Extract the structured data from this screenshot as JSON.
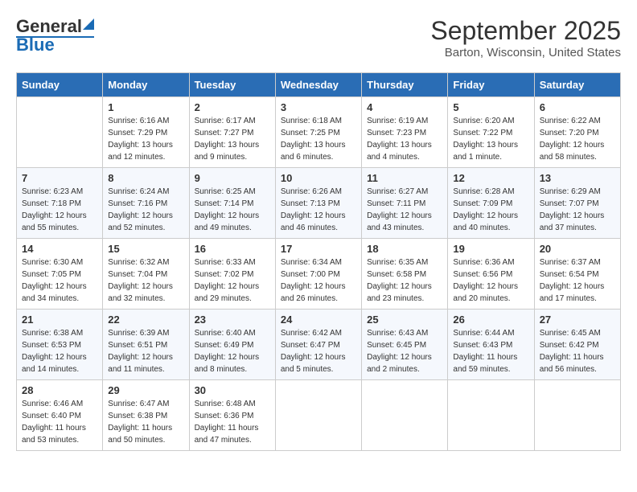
{
  "header": {
    "logo_line1": "General",
    "logo_line2": "Blue",
    "title": "September 2025",
    "subtitle": "Barton, Wisconsin, United States"
  },
  "calendar": {
    "days": [
      "Sunday",
      "Monday",
      "Tuesday",
      "Wednesday",
      "Thursday",
      "Friday",
      "Saturday"
    ],
    "weeks": [
      [
        {
          "date": "",
          "info": ""
        },
        {
          "date": "1",
          "info": "Sunrise: 6:16 AM\nSunset: 7:29 PM\nDaylight: 13 hours\nand 12 minutes."
        },
        {
          "date": "2",
          "info": "Sunrise: 6:17 AM\nSunset: 7:27 PM\nDaylight: 13 hours\nand 9 minutes."
        },
        {
          "date": "3",
          "info": "Sunrise: 6:18 AM\nSunset: 7:25 PM\nDaylight: 13 hours\nand 6 minutes."
        },
        {
          "date": "4",
          "info": "Sunrise: 6:19 AM\nSunset: 7:23 PM\nDaylight: 13 hours\nand 4 minutes."
        },
        {
          "date": "5",
          "info": "Sunrise: 6:20 AM\nSunset: 7:22 PM\nDaylight: 13 hours\nand 1 minute."
        },
        {
          "date": "6",
          "info": "Sunrise: 6:22 AM\nSunset: 7:20 PM\nDaylight: 12 hours\nand 58 minutes."
        }
      ],
      [
        {
          "date": "7",
          "info": "Sunrise: 6:23 AM\nSunset: 7:18 PM\nDaylight: 12 hours\nand 55 minutes."
        },
        {
          "date": "8",
          "info": "Sunrise: 6:24 AM\nSunset: 7:16 PM\nDaylight: 12 hours\nand 52 minutes."
        },
        {
          "date": "9",
          "info": "Sunrise: 6:25 AM\nSunset: 7:14 PM\nDaylight: 12 hours\nand 49 minutes."
        },
        {
          "date": "10",
          "info": "Sunrise: 6:26 AM\nSunset: 7:13 PM\nDaylight: 12 hours\nand 46 minutes."
        },
        {
          "date": "11",
          "info": "Sunrise: 6:27 AM\nSunset: 7:11 PM\nDaylight: 12 hours\nand 43 minutes."
        },
        {
          "date": "12",
          "info": "Sunrise: 6:28 AM\nSunset: 7:09 PM\nDaylight: 12 hours\nand 40 minutes."
        },
        {
          "date": "13",
          "info": "Sunrise: 6:29 AM\nSunset: 7:07 PM\nDaylight: 12 hours\nand 37 minutes."
        }
      ],
      [
        {
          "date": "14",
          "info": "Sunrise: 6:30 AM\nSunset: 7:05 PM\nDaylight: 12 hours\nand 34 minutes."
        },
        {
          "date": "15",
          "info": "Sunrise: 6:32 AM\nSunset: 7:04 PM\nDaylight: 12 hours\nand 32 minutes."
        },
        {
          "date": "16",
          "info": "Sunrise: 6:33 AM\nSunset: 7:02 PM\nDaylight: 12 hours\nand 29 minutes."
        },
        {
          "date": "17",
          "info": "Sunrise: 6:34 AM\nSunset: 7:00 PM\nDaylight: 12 hours\nand 26 minutes."
        },
        {
          "date": "18",
          "info": "Sunrise: 6:35 AM\nSunset: 6:58 PM\nDaylight: 12 hours\nand 23 minutes."
        },
        {
          "date": "19",
          "info": "Sunrise: 6:36 AM\nSunset: 6:56 PM\nDaylight: 12 hours\nand 20 minutes."
        },
        {
          "date": "20",
          "info": "Sunrise: 6:37 AM\nSunset: 6:54 PM\nDaylight: 12 hours\nand 17 minutes."
        }
      ],
      [
        {
          "date": "21",
          "info": "Sunrise: 6:38 AM\nSunset: 6:53 PM\nDaylight: 12 hours\nand 14 minutes."
        },
        {
          "date": "22",
          "info": "Sunrise: 6:39 AM\nSunset: 6:51 PM\nDaylight: 12 hours\nand 11 minutes."
        },
        {
          "date": "23",
          "info": "Sunrise: 6:40 AM\nSunset: 6:49 PM\nDaylight: 12 hours\nand 8 minutes."
        },
        {
          "date": "24",
          "info": "Sunrise: 6:42 AM\nSunset: 6:47 PM\nDaylight: 12 hours\nand 5 minutes."
        },
        {
          "date": "25",
          "info": "Sunrise: 6:43 AM\nSunset: 6:45 PM\nDaylight: 12 hours\nand 2 minutes."
        },
        {
          "date": "26",
          "info": "Sunrise: 6:44 AM\nSunset: 6:43 PM\nDaylight: 11 hours\nand 59 minutes."
        },
        {
          "date": "27",
          "info": "Sunrise: 6:45 AM\nSunset: 6:42 PM\nDaylight: 11 hours\nand 56 minutes."
        }
      ],
      [
        {
          "date": "28",
          "info": "Sunrise: 6:46 AM\nSunset: 6:40 PM\nDaylight: 11 hours\nand 53 minutes."
        },
        {
          "date": "29",
          "info": "Sunrise: 6:47 AM\nSunset: 6:38 PM\nDaylight: 11 hours\nand 50 minutes."
        },
        {
          "date": "30",
          "info": "Sunrise: 6:48 AM\nSunset: 6:36 PM\nDaylight: 11 hours\nand 47 minutes."
        },
        {
          "date": "",
          "info": ""
        },
        {
          "date": "",
          "info": ""
        },
        {
          "date": "",
          "info": ""
        },
        {
          "date": "",
          "info": ""
        }
      ]
    ]
  }
}
